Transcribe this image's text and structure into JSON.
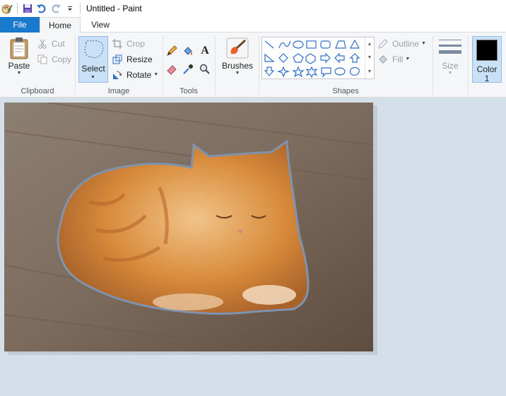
{
  "window": {
    "title": "Untitled - Paint"
  },
  "tabs": {
    "file": "File",
    "home": "Home",
    "view": "View"
  },
  "clipboard": {
    "paste": "Paste",
    "cut": "Cut",
    "copy": "Copy",
    "group": "Clipboard"
  },
  "image": {
    "select": "Select",
    "crop": "Crop",
    "resize": "Resize",
    "rotate": "Rotate",
    "group": "Image"
  },
  "tools": {
    "group": "Tools"
  },
  "brushes": {
    "label": "Brushes"
  },
  "shapes": {
    "outline": "Outline",
    "fill": "Fill",
    "group": "Shapes"
  },
  "size": {
    "label": "Size"
  },
  "colors": {
    "color1_line1": "Color",
    "color1_line2": "1",
    "color1_value": "#000000"
  }
}
